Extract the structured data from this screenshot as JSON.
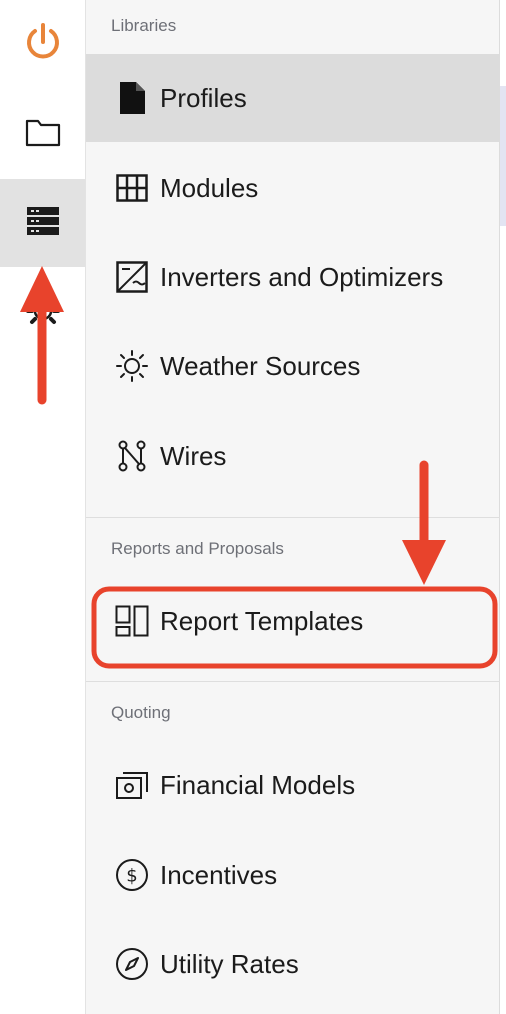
{
  "colors": {
    "accent_orange": "#e8853a",
    "annotation_red": "#e8432c",
    "active_bg": "#dcdcdc"
  },
  "rail": {
    "items": [
      {
        "icon": "power-icon"
      },
      {
        "icon": "folder-icon"
      },
      {
        "icon": "library-list-icon",
        "active": true
      },
      {
        "icon": "gear-icon"
      }
    ]
  },
  "menu": {
    "libraries": {
      "title": "Libraries",
      "items": [
        {
          "label": "Profiles",
          "icon": "document-icon",
          "active": true
        },
        {
          "label": "Modules",
          "icon": "grid-icon"
        },
        {
          "label": "Inverters and Optimizers",
          "icon": "inverter-icon"
        },
        {
          "label": "Weather Sources",
          "icon": "sun-icon"
        },
        {
          "label": "Wires",
          "icon": "wire-icon"
        }
      ]
    },
    "reports": {
      "title": "Reports and Proposals",
      "items": [
        {
          "label": "Report Templates",
          "icon": "report-template-icon"
        }
      ]
    },
    "quoting": {
      "title": "Quoting",
      "items": [
        {
          "label": "Financial Models",
          "icon": "financial-model-icon"
        },
        {
          "label": "Incentives",
          "icon": "dollar-circle-icon"
        },
        {
          "label": "Utility Rates",
          "icon": "gauge-icon"
        }
      ]
    }
  }
}
